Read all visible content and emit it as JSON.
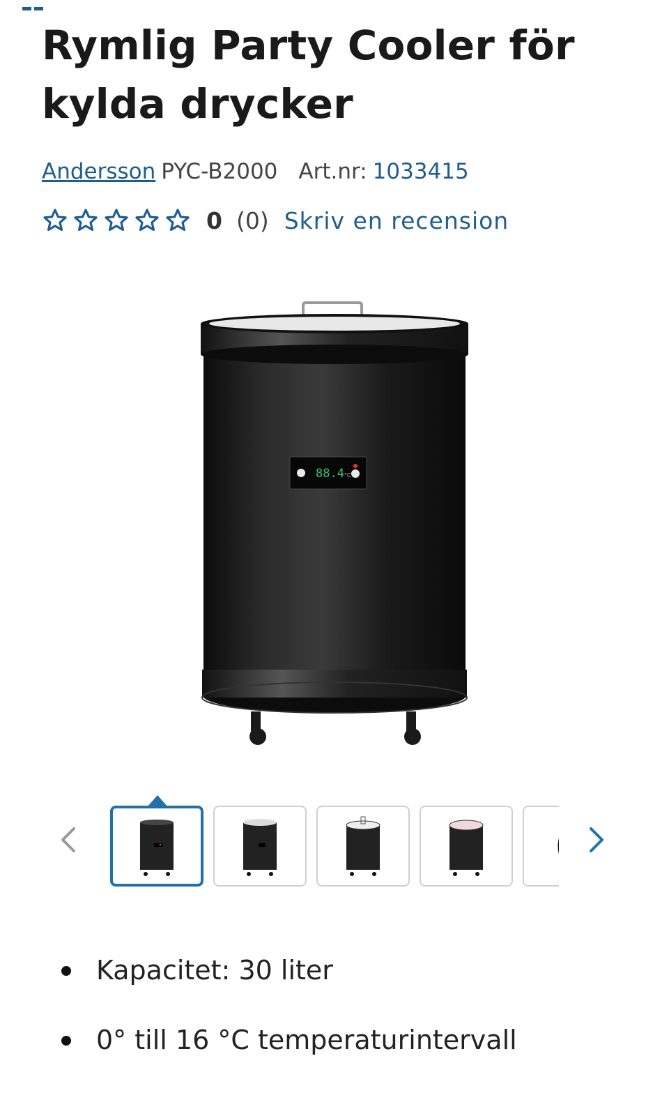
{
  "product": {
    "title_lines": [
      "Rymlig Party Cooler för",
      "kylda drycker"
    ],
    "brand": "Andersson",
    "model": "PYC-B2000",
    "artnr_label": "Art.nr:",
    "artnr_value": "1033415"
  },
  "rating": {
    "stars_filled": 0,
    "stars_total": 5,
    "score": "0",
    "count": "(0)",
    "review_link": "Skriv en recension"
  },
  "gallery": {
    "display_readout": "88.4",
    "display_unit": "°C",
    "thumbnail_count_visible": 5,
    "active_index": 0
  },
  "features": [
    "Kapacitet: 30 liter",
    "0° till 16 °C temperaturintervall"
  ],
  "colors": {
    "accent": "#1f5d8f",
    "active_border": "#1f72a8",
    "text": "#222222"
  },
  "icons": {
    "star": "star-outline-icon",
    "prev": "chevron-left-icon",
    "next": "chevron-right-icon"
  }
}
